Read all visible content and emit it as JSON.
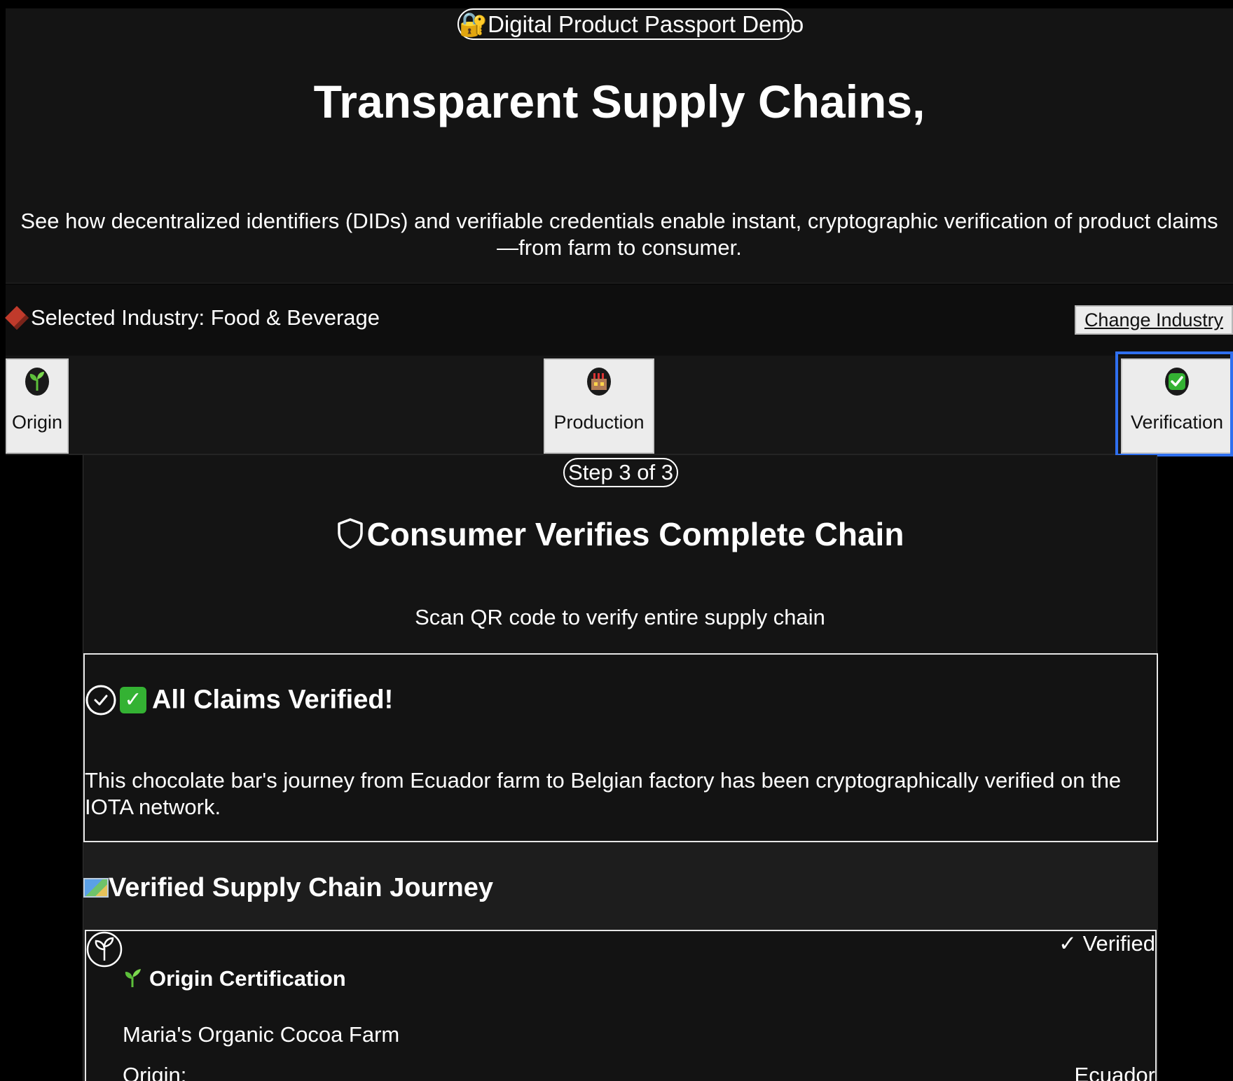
{
  "hero": {
    "badge": "🔐Digital Product Passport Demo",
    "title": "Transparent Supply Chains,",
    "subtitle": "See how decentralized identifiers (DIDs) and verifiable credentials enable instant, cryptographic verification of product claims—from farm to consumer."
  },
  "industry": {
    "label": "Selected Industry: Food & Beverage",
    "change_label": "Change Industry",
    "icon": "chocolate-bar-icon"
  },
  "steps": [
    {
      "label": "Origin",
      "icon": "seedling-icon"
    },
    {
      "label": "Production",
      "icon": "factory-icon"
    },
    {
      "label": "Verification",
      "icon": "check-mark-icon",
      "active": true
    }
  ],
  "step_view": {
    "counter": "Step 3 of 3",
    "title": "Consumer Verifies Complete Chain",
    "description": "Scan QR code to verify entire supply chain"
  },
  "verified": {
    "title": "All Claims Verified!",
    "text": "This chocolate bar's journey from Ecuador farm to Belgian factory has been cryptographically verified on the IOTA network."
  },
  "journey": {
    "title": "Verified Supply Chain Journey",
    "card": {
      "badge": "✓ Verified",
      "title": "Origin Certification",
      "farm": "Maria's Organic Cocoa Farm",
      "row_label": "Origin:",
      "row_value": "Ecuador"
    }
  },
  "colors": {
    "background": "#000000",
    "panel": "#141414",
    "accent_focus": "#2f6fef",
    "success": "#34b233",
    "button_bg": "#ececec"
  }
}
